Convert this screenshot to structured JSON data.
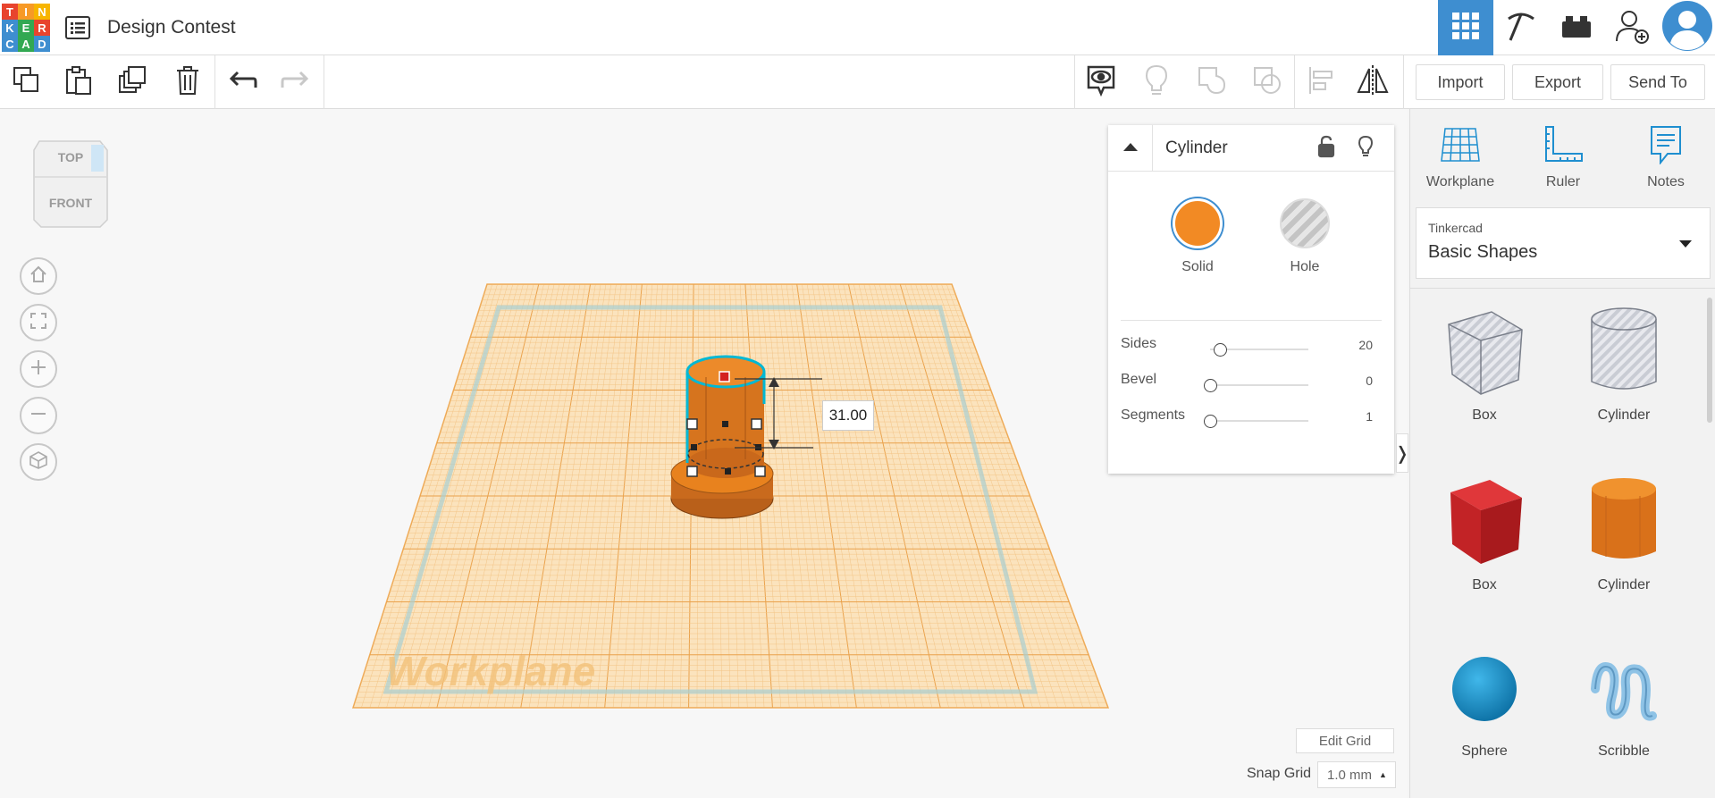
{
  "header": {
    "logo_letters": [
      "T",
      "I",
      "N",
      "K",
      "E",
      "R",
      "C",
      "A",
      "D"
    ],
    "logo_colors": [
      "#e8442e",
      "#f79a26",
      "#f7b500",
      "#3e8ed0",
      "#32a852",
      "#e8442e",
      "#3e8ed0",
      "#32a852",
      "#3e8ed0"
    ],
    "design_title": "Design Contest"
  },
  "toolbar": {
    "import_label": "Import",
    "export_label": "Export",
    "send_to_label": "Send To"
  },
  "viewcube": {
    "top_label": "TOP",
    "front_label": "FRONT"
  },
  "workplane": {
    "watermark": "Workplane",
    "dimension_value": "31.00"
  },
  "inspector": {
    "title": "Cylinder",
    "solid_label": "Solid",
    "hole_label": "Hole",
    "solid_color": "#f28a24",
    "params": [
      {
        "label": "Sides",
        "value": "20",
        "fraction": 0.1
      },
      {
        "label": "Bevel",
        "value": "0",
        "fraction": 0
      },
      {
        "label": "Segments",
        "value": "1",
        "fraction": 0
      }
    ]
  },
  "bottom": {
    "edit_grid_label": "Edit Grid",
    "snap_grid_label": "Snap Grid",
    "snap_grid_value": "1.0 mm"
  },
  "right_panel": {
    "tools": [
      {
        "label": "Workplane",
        "icon": "workplane-icon"
      },
      {
        "label": "Ruler",
        "icon": "ruler-icon"
      },
      {
        "label": "Notes",
        "icon": "notes-icon"
      }
    ],
    "library_vendor": "Tinkercad",
    "library_name": "Basic Shapes",
    "shapes": [
      {
        "label": "Box"
      },
      {
        "label": "Cylinder"
      },
      {
        "label": "Box"
      },
      {
        "label": "Cylinder"
      },
      {
        "label": "Sphere"
      },
      {
        "label": "Scribble"
      }
    ]
  },
  "colors": {
    "accent": "#3e8ed0",
    "workplane_orange": "#f7c98a",
    "shape_red": "#d42b2b",
    "shape_orange": "#e8821e",
    "shape_blue": "#1f95d0"
  }
}
